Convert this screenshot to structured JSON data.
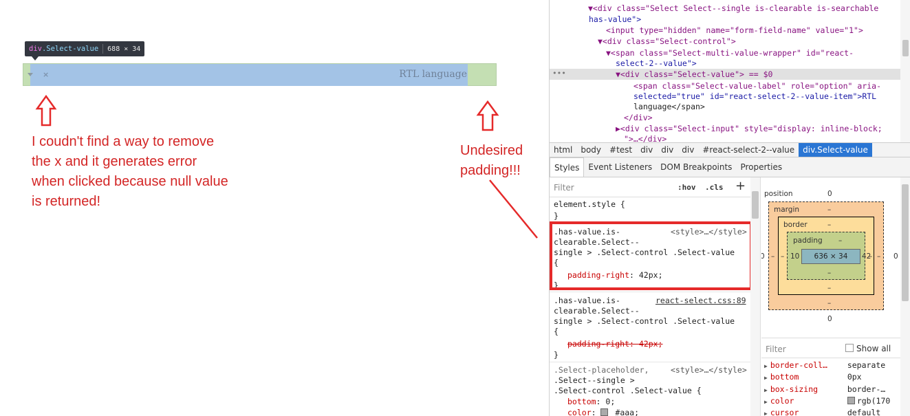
{
  "page": {
    "tooltip": {
      "tag": "div",
      "cls": ".Select-value",
      "dims": "688 × 34"
    },
    "clear_glyph": "×",
    "rtl_label": "RTL language",
    "annotation_left": "I coudn't find a way to remove the x and it generates error when clicked because null value is returned!",
    "annotation_right": "Undesired padding!!!",
    "colors": {
      "annotation": "#d32525",
      "margin_highlight": "#c4dfb3",
      "content_highlight": "#a3c3e6"
    }
  },
  "devtools": {
    "dom": [
      {
        "text": "▼<div class=\"Select Select--single is-clearable is-searchable",
        "indent": 0
      },
      {
        "text": "has-value\">",
        "indent": 1
      },
      {
        "text": "<input type=\"hidden\" name=\"form-field-name\" value=\"1\">",
        "indent": 2
      },
      {
        "text": "▼<div class=\"Select-control\">",
        "indent": 3
      },
      {
        "text": "▼<span class=\"Select-multi-value-wrapper\" id=\"react-",
        "indent": 4
      },
      {
        "text": "select-2--value\">",
        "indent": 5
      },
      {
        "text": "▼<div class=\"Select-value\"> == $0",
        "indent": 6
      },
      {
        "text": "<span class=\"Select-value-label\" role=\"option\" aria-",
        "indent": 7
      },
      {
        "text": "selected=\"true\" id=\"react-select-2--value-item\">RTL",
        "indent": 7
      },
      {
        "text": "language</span>",
        "indent": 7
      },
      {
        "text": "</div>",
        "indent": 8
      },
      {
        "text": "▶<div class=\"Select-input\" style=\"display: inline-block;",
        "indent": 9
      },
      {
        "text": "\">…</div>",
        "indent": 10
      }
    ],
    "dots": "•••",
    "breadcrumb": [
      "html",
      "body",
      "#test",
      "div",
      "div",
      "div",
      "#react-select-2--value",
      "div.Select-value"
    ],
    "tabs": [
      "Styles",
      "Event Listeners",
      "DOM Breakpoints",
      "Properties"
    ],
    "styles": {
      "filter_placeholder": "Filter",
      "hov": ":hov",
      "cls": ".cls",
      "plus": "+",
      "element_style": "element.style {",
      "close_brace": "}",
      "rule1_selector": [
        ".has-value.is-",
        "clearable.Select--",
        "single > .Select-control .Select-value",
        "{"
      ],
      "rule1_source": "<style>…</style>",
      "rule1_prop": "padding-right",
      "rule1_value": " 42px;",
      "rule2_selector": [
        ".has-value.is-",
        "clearable.Select--",
        "single > .Select-control .Select-value",
        "{"
      ],
      "rule2_source": "react-select.css:89",
      "rule2_prop": "padding-right: 42px;",
      "rule3_selector": [
        ".Select-placeholder,",
        ".Select--single >",
        ".Select-control .Select-value {"
      ],
      "rule3_source": "<style>…</style>",
      "rule3_prop1": "bottom",
      "rule3_val1": " 0;",
      "rule3_prop2": "color",
      "rule3_val2": " #aaa;"
    },
    "box_model": {
      "position_label": "position",
      "position_top": "0",
      "position_bottom": "0",
      "position_left": "0",
      "position_right": "0",
      "margin_label": "margin",
      "margin_val": "–",
      "border_label": "border",
      "border_val": "–",
      "padding_label": "padding",
      "padding_top": "–",
      "padding_bottom": "–",
      "padding_left": "10",
      "padding_right": "42",
      "content": "636 × 34",
      "side_dash": "–"
    },
    "computed": {
      "filter_placeholder": "Filter",
      "show_all": "Show all",
      "props": [
        {
          "name": "border-coll…",
          "value": "separate",
          "swatch": false
        },
        {
          "name": "bottom",
          "value": "0px",
          "swatch": false
        },
        {
          "name": "box-sizing",
          "value": "border-…",
          "swatch": false
        },
        {
          "name": "color",
          "value": "rgb(170",
          "swatch": true
        },
        {
          "name": "cursor",
          "value": "default",
          "swatch": false
        }
      ]
    }
  }
}
